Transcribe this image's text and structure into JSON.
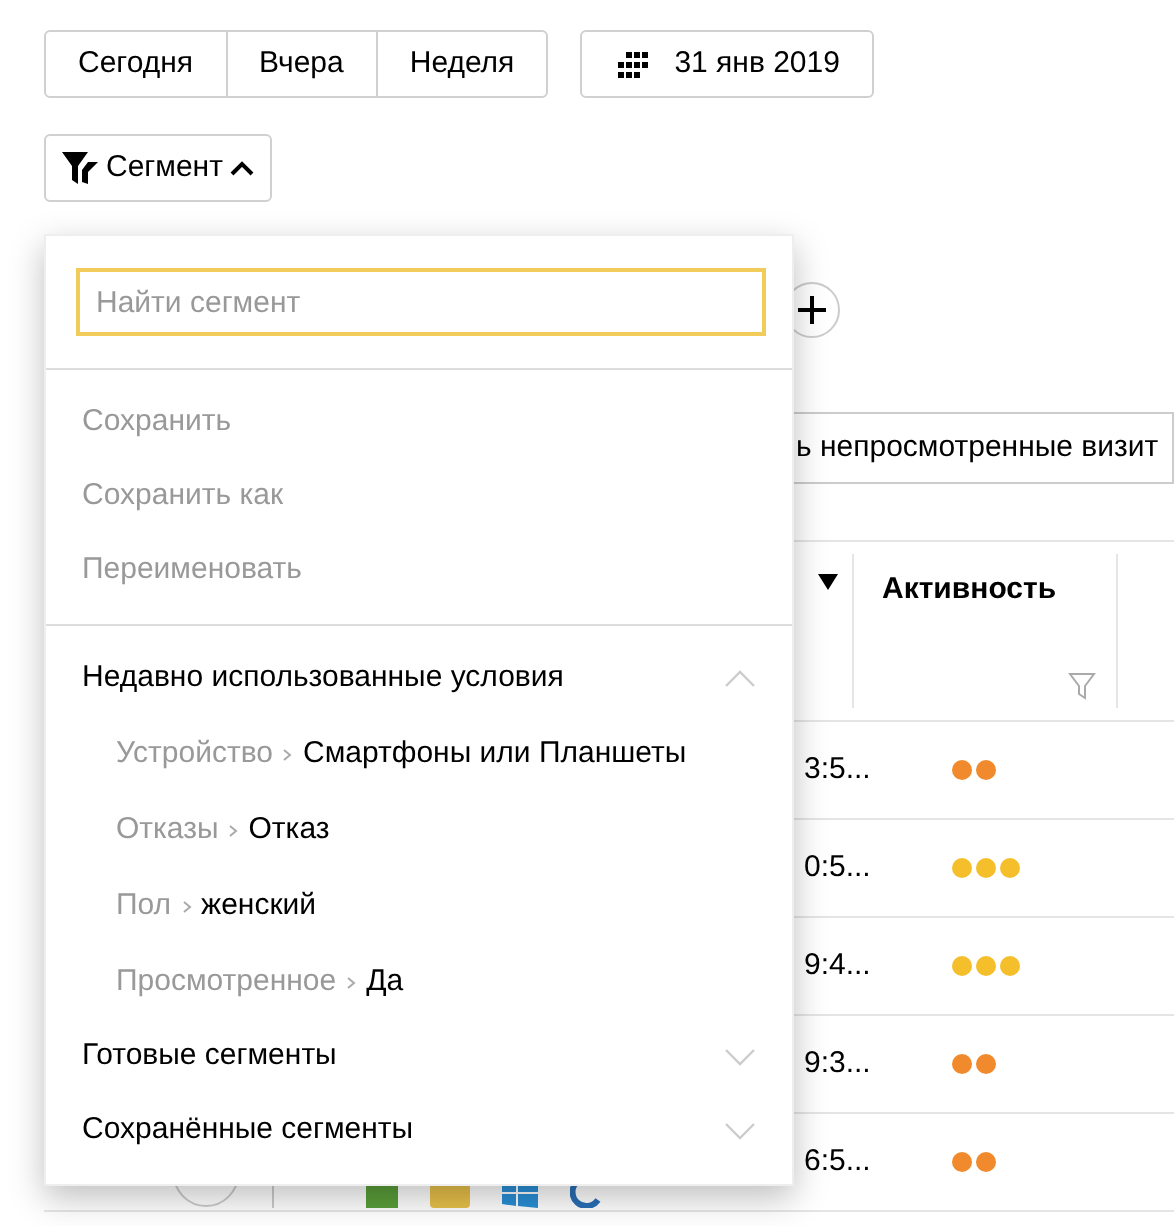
{
  "date_buttons": [
    {
      "label": "Сегодня"
    },
    {
      "label": "Вчера"
    },
    {
      "label": "Неделя"
    }
  ],
  "date_picker": {
    "label": "31 янв 2019"
  },
  "segment_button": {
    "label": "Сегмент",
    "expanded": true
  },
  "segment_menu": {
    "search": {
      "placeholder": "Найти сегмент"
    },
    "actions": [
      {
        "label": "Сохранить",
        "disabled": true
      },
      {
        "label": "Сохранить как",
        "disabled": true
      },
      {
        "label": "Переименовать",
        "disabled": true
      }
    ],
    "sections": [
      {
        "label": "Недавно использованные условия",
        "expanded": true,
        "conditions": [
          {
            "category": "Устройство",
            "value": "Смартфоны или Планшеты"
          },
          {
            "category": "Отказы",
            "value": "Отказ"
          },
          {
            "category": "Пол",
            "value": "женский"
          },
          {
            "category": "Просмотренное",
            "value": "Да"
          }
        ]
      },
      {
        "label": "Готовые сегменты",
        "expanded": false
      },
      {
        "label": "Сохранённые сегменты",
        "expanded": false
      }
    ]
  },
  "filter_field": {
    "value": "ь непросмотренные визит"
  },
  "table": {
    "columns": [
      {
        "label": "Активность"
      }
    ],
    "rows": [
      {
        "time": "3:5...",
        "activity_dots": [
          {
            "color": "#f08a2c"
          },
          {
            "color": "#f08a2c"
          }
        ]
      },
      {
        "time": "0:5...",
        "activity_dots": [
          {
            "color": "#f5bf2c"
          },
          {
            "color": "#f5bf2c"
          },
          {
            "color": "#f5bf2c"
          }
        ]
      },
      {
        "time": "9:4...",
        "activity_dots": [
          {
            "color": "#f5bf2c"
          },
          {
            "color": "#f5bf2c"
          },
          {
            "color": "#f5bf2c"
          }
        ]
      },
      {
        "time": "9:3...",
        "activity_dots": [
          {
            "color": "#f08a2c"
          },
          {
            "color": "#f08a2c"
          }
        ]
      },
      {
        "time": "6:5...",
        "activity_dots": [
          {
            "color": "#f08a2c"
          },
          {
            "color": "#f08a2c"
          }
        ]
      }
    ]
  }
}
